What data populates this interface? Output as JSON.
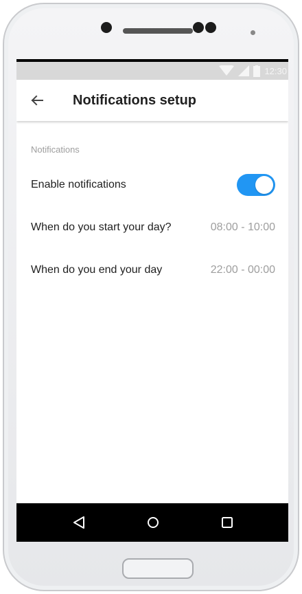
{
  "status_bar": {
    "time": "12:30"
  },
  "app_bar": {
    "title": "Notifications setup"
  },
  "section": {
    "header": "Notifications"
  },
  "settings": {
    "enable_notifications": {
      "label": "Enable notifications",
      "enabled": true
    },
    "start_day": {
      "label": "When do you start your day?",
      "value": "08:00 - 10:00"
    },
    "end_day": {
      "label": "When do you end your day",
      "value": "22:00 - 00:00"
    }
  },
  "icons": {
    "back": "arrow-back-icon",
    "nav_back": "triangle-back-icon",
    "nav_home": "circle-home-icon",
    "nav_recents": "square-recents-icon"
  },
  "colors": {
    "accent": "#2196f3",
    "status_bar": "#d8d8d8",
    "secondary_text": "#9e9e9e",
    "primary_text": "#212121"
  }
}
